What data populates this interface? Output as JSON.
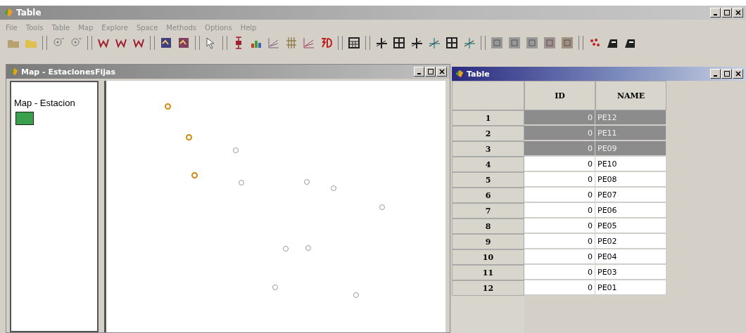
{
  "window": {
    "title": "Table"
  },
  "menu": [
    "File",
    "Tools",
    "Table",
    "Map",
    "Explore",
    "Space",
    "Methods",
    "Options",
    "Help"
  ],
  "map_window": {
    "title": "Map - EstacionesFijas",
    "legend_title": "Map - Estacion",
    "points": [
      {
        "selected": true
      },
      {
        "selected": true
      },
      {
        "selected": false
      },
      {
        "selected": true
      },
      {
        "selected": false
      },
      {
        "selected": false
      },
      {
        "selected": false
      },
      {
        "selected": false
      },
      {
        "selected": false
      },
      {
        "selected": false
      },
      {
        "selected": false
      },
      {
        "selected": false
      }
    ]
  },
  "table_window": {
    "title": "Table",
    "columns": [
      "ID",
      "NAME"
    ],
    "rows": [
      {
        "num": "1",
        "id": "0",
        "name": "PE12",
        "selected": true
      },
      {
        "num": "2",
        "id": "0",
        "name": "PE11",
        "selected": true
      },
      {
        "num": "3",
        "id": "0",
        "name": "PE09",
        "selected": true
      },
      {
        "num": "4",
        "id": "0",
        "name": "PE10",
        "selected": false
      },
      {
        "num": "5",
        "id": "0",
        "name": "PE08",
        "selected": false
      },
      {
        "num": "6",
        "id": "0",
        "name": "PE07",
        "selected": false
      },
      {
        "num": "7",
        "id": "0",
        "name": "PE06",
        "selected": false
      },
      {
        "num": "8",
        "id": "0",
        "name": "PE05",
        "selected": false
      },
      {
        "num": "9",
        "id": "0",
        "name": "PE02",
        "selected": false
      },
      {
        "num": "10",
        "id": "0",
        "name": "PE04",
        "selected": false
      },
      {
        "num": "11",
        "id": "0",
        "name": "PE03",
        "selected": false
      },
      {
        "num": "12",
        "id": "0",
        "name": "PE01",
        "selected": false
      }
    ]
  }
}
